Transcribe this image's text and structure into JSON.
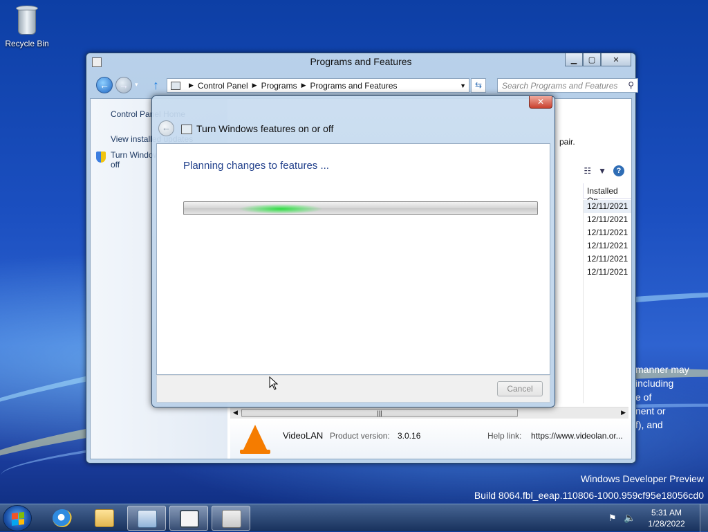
{
  "desktop": {
    "recycle_bin": "Recycle Bin",
    "background_text": [
      "manner may",
      "including",
      "e of",
      "nent or",
      "f), and"
    ],
    "watermark_line1": "Windows Developer Preview",
    "watermark_line2": "Build 8064.fbl_eeap.110806-1000.959cf95e18056cd0"
  },
  "window": {
    "title": "Programs and Features",
    "breadcrumb": [
      "Control Panel",
      "Programs",
      "Programs and Features"
    ],
    "search_placeholder": "Search Programs and Features",
    "left_pane": {
      "home": "Control Panel Home",
      "view_installed": "View installed updates",
      "turn_features_line1": "Turn Windows features on or",
      "turn_features_line2": "off"
    },
    "repair_text": "pair.",
    "column_installed_on": "Installed On",
    "installed_dates": [
      "12/11/2021",
      "12/11/2021",
      "12/11/2021",
      "12/11/2021",
      "12/11/2021",
      "12/11/2021"
    ],
    "scroll_grip": "|||",
    "details": {
      "publisher": "VideoLAN",
      "product_version_label": "Product version:",
      "product_version": "3.0.16",
      "help_link_label": "Help link:",
      "help_link": "https://www.videolan.or..."
    }
  },
  "dialog": {
    "title": "Turn Windows features on or off",
    "status": "Planning changes to features ...",
    "progress_state": "indeterminate",
    "cancel_label": "Cancel",
    "close_glyph": "✕"
  },
  "taskbar": {
    "time": "5:31 AM",
    "date": "1/28/2022"
  },
  "colors": {
    "accent_link": "#1f3e8a",
    "progress_glow": "#28dc3c",
    "close_red": "#c9412f"
  }
}
